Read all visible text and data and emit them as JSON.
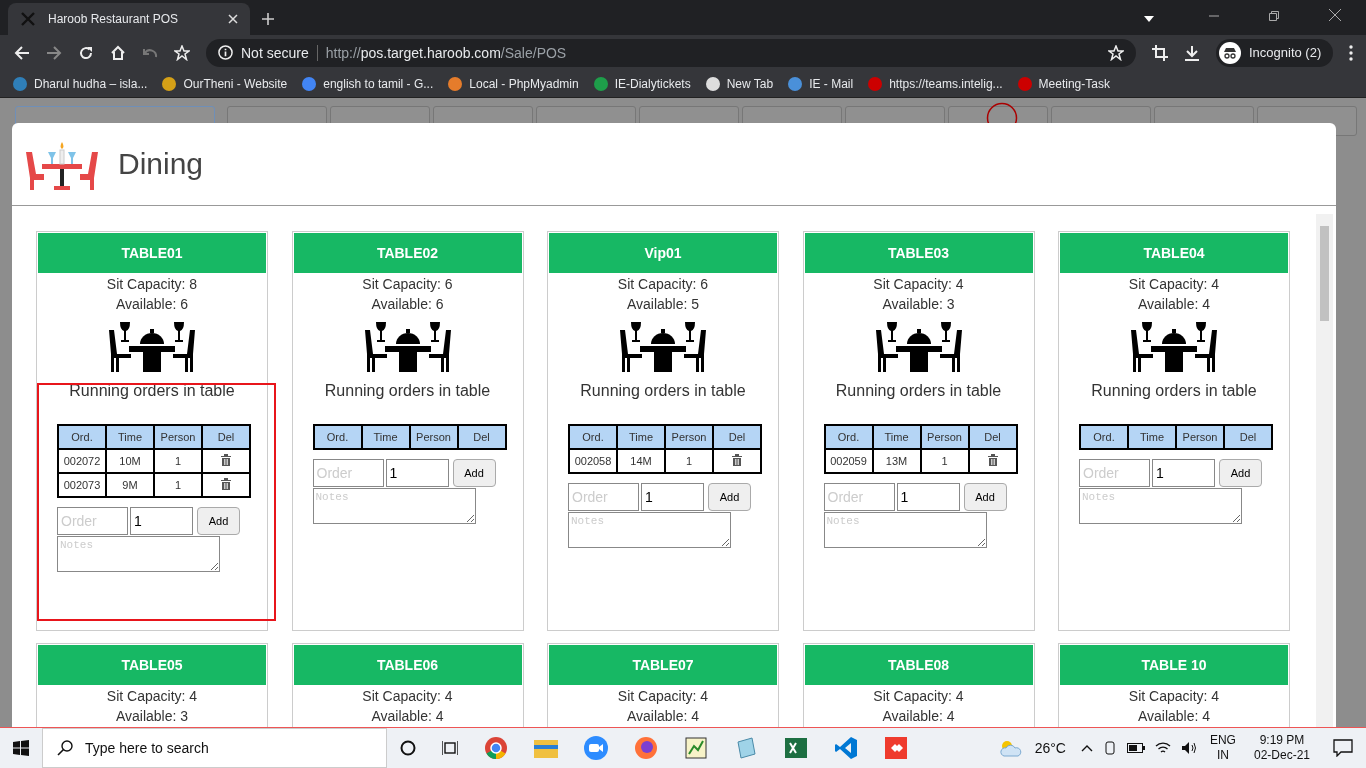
{
  "browser": {
    "tab_title": "Haroob Restaurant POS",
    "security": "Not secure",
    "url_scheme": "http://",
    "url_host": "pos.target.haroob.com",
    "url_path": "/Sale/POS",
    "profile": "Incognito (2)",
    "bookmarks": [
      {
        "label": "Dharul hudha – isla..."
      },
      {
        "label": "OurTheni - Website"
      },
      {
        "label": "english to tamil - G..."
      },
      {
        "label": "Local - PhpMyadmin"
      },
      {
        "label": "IE-Dialytickets"
      },
      {
        "label": "New Tab"
      },
      {
        "label": "IE - Mail"
      },
      {
        "label": "https://teams.intelig..."
      },
      {
        "label": "Meeting-Task"
      }
    ]
  },
  "category_tabs": [
    {
      "selected": true
    },
    {
      "selected": false
    },
    {
      "selected": false
    },
    {
      "selected": false
    },
    {
      "selected": false
    },
    {
      "selected": false
    },
    {
      "selected": false
    },
    {
      "selected": false
    },
    {
      "selected": false
    },
    {
      "selected": false
    },
    {
      "selected": false
    },
    {
      "selected": false
    }
  ],
  "modal": {
    "title": "Dining",
    "tables": [
      {
        "name": "TABLE01",
        "capacity": "Sit Capacity: 8",
        "available": "Available: 6",
        "orders_title": "Running orders in table",
        "columns": [
          "Ord.",
          "Time",
          "Person",
          "Del"
        ],
        "orders": [
          {
            "ord": "002072",
            "time": "10M",
            "person": "1"
          },
          {
            "ord": "002073",
            "time": "9M",
            "person": "1"
          }
        ],
        "order_placeholder": "Order",
        "person_value": "1",
        "add": "Add",
        "notes_placeholder": "Notes",
        "highlighted": true
      },
      {
        "name": "TABLE02",
        "capacity": "Sit Capacity: 6",
        "available": "Available: 6",
        "orders_title": "Running orders in table",
        "columns": [
          "Ord.",
          "Time",
          "Person",
          "Del"
        ],
        "order_placeholder": "Order",
        "person_value": "1",
        "add": "Add",
        "notes_placeholder": "Notes",
        "highlighted": false
      },
      {
        "name": "Vip01",
        "capacity": "Sit Capacity: 6",
        "available": "Available: 5",
        "orders_title": "Running orders in table",
        "columns": [
          "Ord.",
          "Time",
          "Person",
          "Del"
        ],
        "orders": [
          {
            "ord": "002058",
            "time": "14M",
            "person": "1"
          }
        ],
        "order_placeholder": "Order",
        "person_value": "1",
        "add": "Add",
        "notes_placeholder": "Notes",
        "highlighted": false
      },
      {
        "name": "TABLE03",
        "capacity": "Sit Capacity: 4",
        "available": "Available: 3",
        "orders_title": "Running orders in table",
        "columns": [
          "Ord.",
          "Time",
          "Person",
          "Del"
        ],
        "orders": [
          {
            "ord": "002059",
            "time": "13M",
            "person": "1"
          }
        ],
        "order_placeholder": "Order",
        "person_value": "1",
        "add": "Add",
        "notes_placeholder": "Notes",
        "highlighted": false
      },
      {
        "name": "TABLE04",
        "capacity": "Sit Capacity: 4",
        "available": "Available: 4",
        "orders_title": "Running orders in table",
        "columns": [
          "Ord.",
          "Time",
          "Person",
          "Del"
        ],
        "order_placeholder": "Order",
        "person_value": "1",
        "add": "Add",
        "notes_placeholder": "Notes",
        "highlighted": false
      },
      {
        "name": "TABLE05",
        "capacity": "Sit Capacity: 4",
        "available": "Available: 3"
      },
      {
        "name": "TABLE06",
        "capacity": "Sit Capacity: 4",
        "available": "Available: 4"
      },
      {
        "name": "TABLE07",
        "capacity": "Sit Capacity: 4",
        "available": "Available: 4"
      },
      {
        "name": "TABLE08",
        "capacity": "Sit Capacity: 4",
        "available": "Available: 4"
      },
      {
        "name": "TABLE 10",
        "capacity": "Sit Capacity: 4",
        "available": "Available: 4"
      }
    ]
  },
  "taskbar": {
    "search_placeholder": "Type here to search",
    "temperature": "26°C",
    "language": "ENG",
    "region": "IN",
    "time": "9:19 PM",
    "date": "02-Dec-21"
  }
}
